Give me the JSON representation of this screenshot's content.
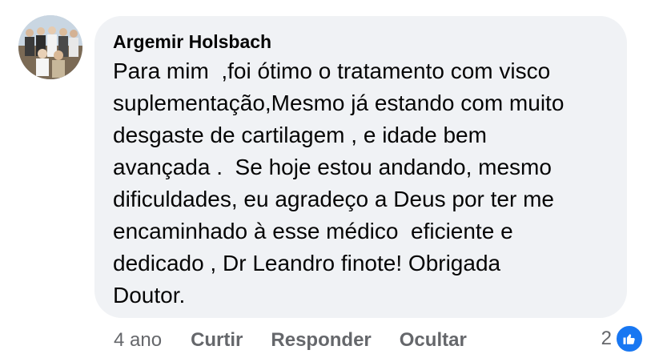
{
  "comment": {
    "author": "Argemir Holsbach",
    "text": "Para mim  ,foi ótimo o tratamento com visco\nsuplementação,Mesmo já estando com muito\ndesgaste de cartilagem , e idade bem\navançada .  Se hoje estou andando, mesmo\ndificuldades, eu agradeço a Deus por ter me\nencaminhado à esse médico  eficiente e\ndedicado , Dr Leandro finote! Obrigada\nDoutor.",
    "time": "4 ano",
    "actions": {
      "like": "Curtir",
      "reply": "Responder",
      "hide": "Ocultar"
    },
    "reaction_count": "2",
    "reaction_icon": "like-icon"
  },
  "colors": {
    "bubble_bg": "#f0f2f5",
    "text": "#050505",
    "secondary_text": "#65676b",
    "like_blue": "#1877f2"
  }
}
